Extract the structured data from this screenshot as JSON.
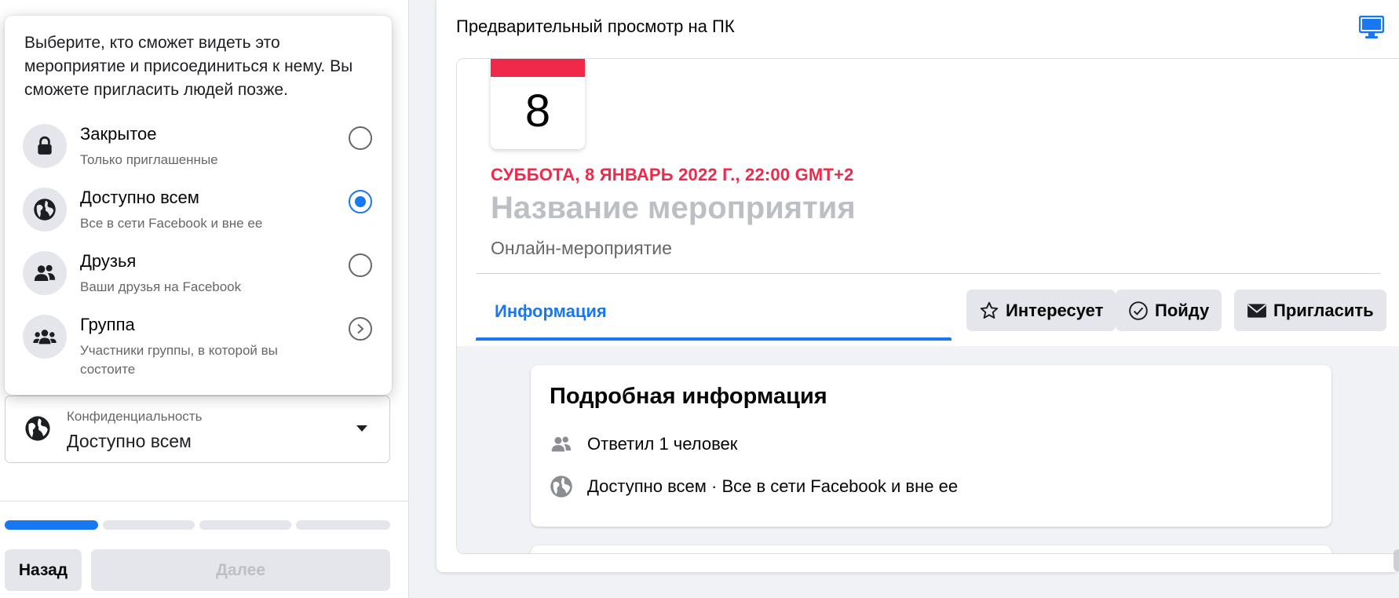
{
  "privacy_dropdown": {
    "intro": "Выберите, кто сможет видеть это мероприятие и присоединиться к нему. Вы сможете пригласить людей позже.",
    "options": [
      {
        "title": "Закрытое",
        "description": "Только приглашенные",
        "icon": "lock-icon",
        "selected": false
      },
      {
        "title": "Доступно всем",
        "description": "Все в сети Facebook и вне ее",
        "icon": "globe-icon",
        "selected": true
      },
      {
        "title": "Друзья",
        "description": "Ваши друзья на Facebook",
        "icon": "friends-icon",
        "selected": false
      },
      {
        "title": "Группа",
        "description": "Участники группы, в которой вы состоите",
        "icon": "group-icon",
        "selected": false,
        "has_submenu": true
      }
    ]
  },
  "privacy_field": {
    "label": "Конфиденциальность",
    "value": "Доступно всем",
    "icon": "globe-icon"
  },
  "progress": {
    "steps": 4,
    "current_step": 1
  },
  "footer": {
    "back_label": "Назад",
    "next_label": "Далее",
    "next_disabled": true
  },
  "preview": {
    "title": "Предварительный просмотр на ПК",
    "device_icon": "desktop-icon",
    "calendar_day": "8",
    "event_date": "СУББОТА, 8 ЯНВАРЬ 2022 Г., 22:00 GMT+2",
    "event_name": "Название мероприятия",
    "event_type": "Онлайн-мероприятие",
    "tab_info": "Информация",
    "buttons": {
      "interested": "Интересует",
      "going": "Пойду",
      "invite": "Пригласить"
    },
    "details": {
      "title": "Подробная информация",
      "responded": "Ответил 1 человек",
      "privacy": "Доступно всем · Все в сети Facebook и вне ее"
    }
  },
  "colors": {
    "accent": "#1877f2",
    "date_red": "#f02849",
    "muted": "#65676b",
    "button_bg": "#e4e6eb"
  }
}
